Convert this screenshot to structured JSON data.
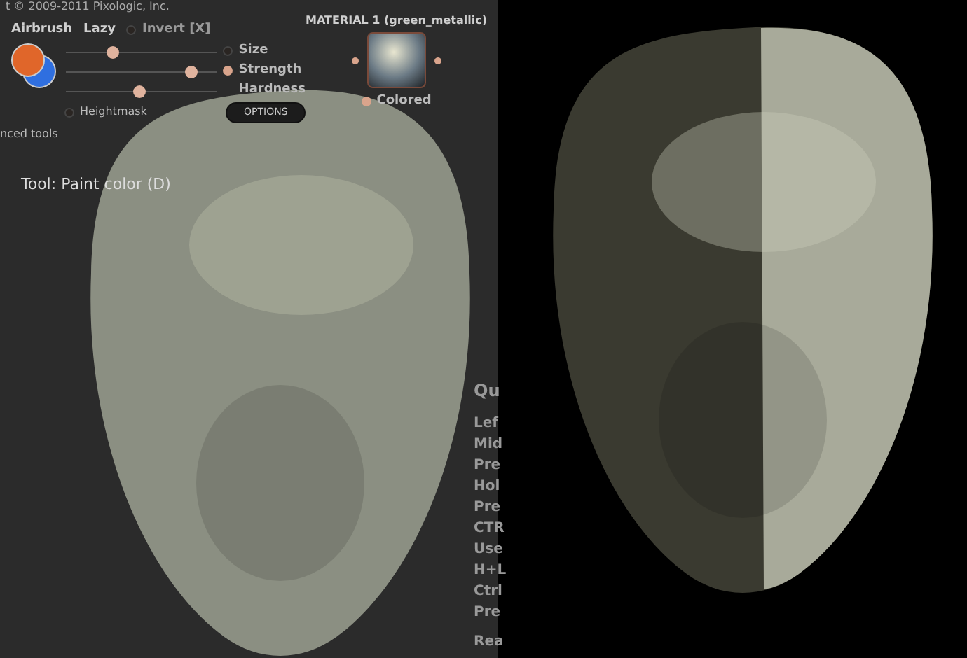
{
  "copyright": "t © 2009-2011 Pixologic, Inc.",
  "brush": {
    "name": "Airbrush",
    "lazy_label": "Lazy",
    "invert": {
      "label": "Invert [X]",
      "on": false
    },
    "colors": [
      {
        "color": "#e0662a"
      },
      {
        "color": "#2f6fe0"
      }
    ],
    "sliders": [
      {
        "level": 0.3
      },
      {
        "level": 0.82
      },
      {
        "level": 0.48
      }
    ],
    "params": [
      {
        "label": "Size",
        "kind": "toggle",
        "on": false
      },
      {
        "label": "Strength",
        "kind": "toggle",
        "on": true
      },
      {
        "label": "Hardness",
        "kind": "plain"
      }
    ],
    "heightmask": {
      "label": "Heightmask",
      "on": false
    },
    "options_button": "OPTIONS"
  },
  "material": {
    "title": "MATERIAL 1 (green_metallic)",
    "colored": {
      "label": "Colored",
      "on": true
    }
  },
  "advanced_tools": "nced tools",
  "tool": "Tool: Paint color (D)",
  "help_title": "Qu",
  "help_lines": [
    "Lef",
    "Mid",
    "Pre",
    "Hol",
    "Pre",
    "CTR",
    "Use",
    "H+L",
    "Ctrl",
    "Pre"
  ],
  "help_footer": "Rea"
}
